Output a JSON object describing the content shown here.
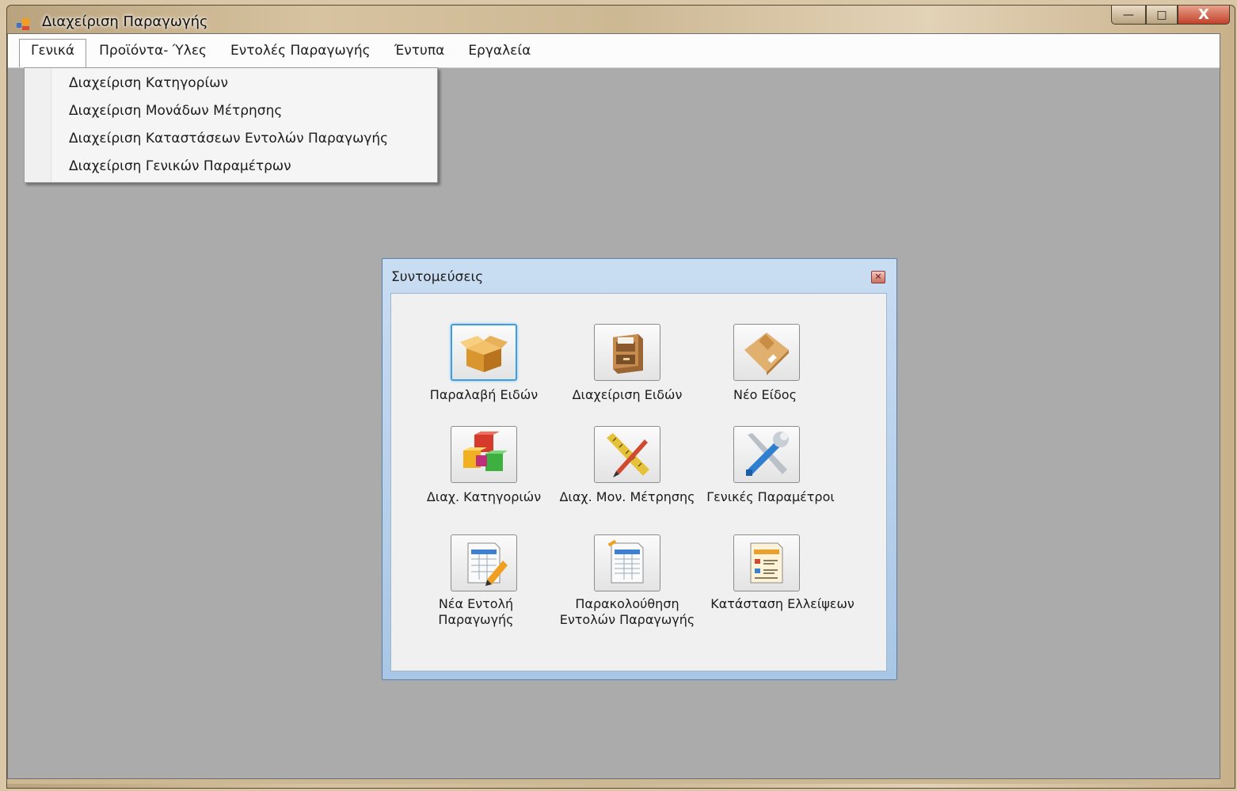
{
  "window": {
    "title": "Διαχείριση Παραγωγής",
    "buttons": {
      "minimize": "—",
      "maximize": "□",
      "close": "X"
    }
  },
  "menubar": {
    "items": [
      {
        "label": "Γενικά",
        "open": true
      },
      {
        "label": "Προϊόντα- Ύλες"
      },
      {
        "label": "Εντολές Παραγωγής"
      },
      {
        "label": "Έντυπα"
      },
      {
        "label": "Εργαλεία"
      }
    ]
  },
  "dropdown": {
    "items": [
      {
        "label": "Διαχείριση Κατηγορίων"
      },
      {
        "label": "Διαχείριση Μονάδων Μέτρησης"
      },
      {
        "label": "Διαχείριση Καταστάσεων Εντολών Παραγωγής"
      },
      {
        "label": "Διαχείριση Γενικών Παραμέτρων"
      }
    ]
  },
  "shortcuts": {
    "title": "Συντομεύσεις",
    "close_glyph": "✕",
    "items": [
      {
        "label": "Παραλαβή Ειδών",
        "icon": "open-box-icon"
      },
      {
        "label": "Διαχείριση Ειδών",
        "icon": "file-cabinet-icon"
      },
      {
        "label": "Νέο Είδος",
        "icon": "package-icon"
      },
      {
        "label": "Διαχ. Κατηγοριών",
        "icon": "colored-cubes-icon"
      },
      {
        "label": "Διαχ. Μον. Μέτρησης",
        "icon": "ruler-pencil-icon"
      },
      {
        "label": "Γενικές Παραμέτροι",
        "icon": "tools-icon"
      },
      {
        "label_line1": "Νέα Εντολή",
        "label_line2": "Παραγωγής",
        "icon": "new-order-sheet-icon"
      },
      {
        "label_line1": "Παρακολούθηση",
        "label_line2": "Εντολών Παραγωγής",
        "icon": "table-sheet-icon"
      },
      {
        "label": "Κατάσταση Ελλείψεων",
        "icon": "report-sheet-icon"
      }
    ]
  },
  "colors": {
    "client_bg": "#ababab",
    "dialog_frame": "#b9d1ec",
    "focus_border": "#3c9fe0"
  }
}
